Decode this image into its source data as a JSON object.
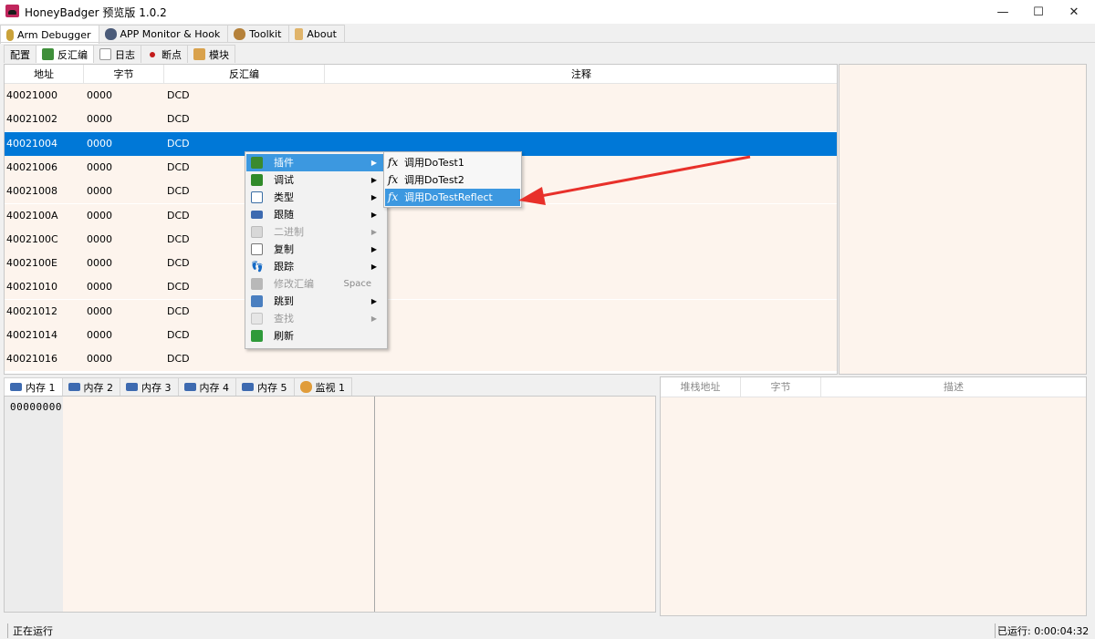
{
  "window": {
    "title": "HoneyBadger 预览版 1.0.2",
    "minimize": "—",
    "maximize": "☐",
    "close": "✕"
  },
  "top_tabs": [
    {
      "label": "Arm Debugger",
      "icon": "arm-debugger-icon",
      "active": true
    },
    {
      "label": "APP Monitor & Hook",
      "icon": "monitor-icon",
      "active": false
    },
    {
      "label": "Toolkit",
      "icon": "toolkit-icon",
      "active": false
    },
    {
      "label": "About",
      "icon": "about-icon",
      "active": false
    }
  ],
  "sub_tabs": [
    {
      "label": "配置",
      "active": false
    },
    {
      "label": "反汇编",
      "icon": "disasm-icon",
      "active": true
    },
    {
      "label": "日志",
      "icon": "log-icon",
      "active": false
    },
    {
      "label": "断点",
      "icon": "breakpoint-icon",
      "active": false
    },
    {
      "label": "模块",
      "icon": "module-icon",
      "active": false
    }
  ],
  "disasm": {
    "columns": [
      "地址",
      "字节",
      "反汇编",
      "注释"
    ],
    "rows": [
      {
        "addr": "40021000",
        "bytes": "0000",
        "asm": "DCD"
      },
      {
        "addr": "40021002",
        "bytes": "0000",
        "asm": "DCD"
      },
      {
        "addr": "40021004",
        "bytes": "0000",
        "asm": "DCD",
        "selected": true
      },
      {
        "addr": "40021006",
        "bytes": "0000",
        "asm": "DCD"
      },
      {
        "addr": "40021008",
        "bytes": "0000",
        "asm": "DCD"
      },
      {
        "addr": "4002100A",
        "bytes": "0000",
        "asm": "DCD"
      },
      {
        "addr": "4002100C",
        "bytes": "0000",
        "asm": "DCD"
      },
      {
        "addr": "4002100E",
        "bytes": "0000",
        "asm": "DCD"
      },
      {
        "addr": "40021010",
        "bytes": "0000",
        "asm": "DCD"
      },
      {
        "addr": "40021012",
        "bytes": "0000",
        "asm": "DCD"
      },
      {
        "addr": "40021014",
        "bytes": "0000",
        "asm": "DCD"
      },
      {
        "addr": "40021016",
        "bytes": "0000",
        "asm": "DCD"
      }
    ]
  },
  "context_menu": {
    "items": [
      {
        "label": "插件",
        "icon": "plugin-icon",
        "submenu": true,
        "highlighted": true
      },
      {
        "label": "调试",
        "icon": "debug-icon",
        "submenu": true
      },
      {
        "label": "类型",
        "icon": "type-icon",
        "submenu": true
      },
      {
        "label": "跟随",
        "icon": "follow-icon",
        "submenu": true
      },
      {
        "label": "二进制",
        "icon": "binary-icon",
        "submenu": true,
        "disabled": true
      },
      {
        "label": "复制",
        "icon": "copy-icon",
        "submenu": true
      },
      {
        "label": "跟踪",
        "icon": "trace-icon",
        "submenu": true
      },
      {
        "label": "修改汇编",
        "icon": "modify-asm-icon",
        "shortcut": "Space",
        "disabled": true
      },
      {
        "label": "跳到",
        "icon": "goto-icon",
        "submenu": true
      },
      {
        "label": "查找",
        "icon": "find-icon",
        "submenu": true,
        "disabled": true
      },
      {
        "label": "刷新",
        "icon": "refresh-icon"
      }
    ]
  },
  "plugin_submenu": {
    "items": [
      {
        "label": "调用DoTest1",
        "icon": "fx"
      },
      {
        "label": "调用DoTest2",
        "icon": "fx"
      },
      {
        "label": "调用DoTestReflect",
        "icon": "fx",
        "highlighted": true
      }
    ]
  },
  "memory_tabs": [
    {
      "label": "内存 1",
      "active": true
    },
    {
      "label": "内存 2"
    },
    {
      "label": "内存 3"
    },
    {
      "label": "内存 4"
    },
    {
      "label": "内存 5"
    },
    {
      "label": "监视 1",
      "icon": "watch-icon"
    }
  ],
  "memory": {
    "address": "00000000"
  },
  "stack": {
    "columns": [
      "堆栈地址",
      "字节",
      "描述"
    ]
  },
  "status": {
    "left": "正在运行",
    "right": "已运行: 0:00:04:32"
  },
  "colors": {
    "selection": "#0078d7",
    "row_bg": "#fdf4ed",
    "menu_highlight": "#3c98e0",
    "annotation_arrow": "#e8302a"
  }
}
